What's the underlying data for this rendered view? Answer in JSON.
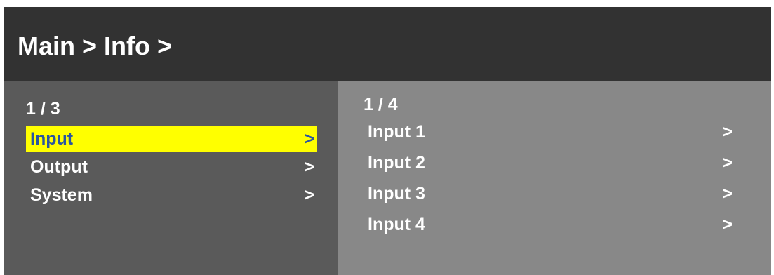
{
  "header": {
    "title": "Main > Info >"
  },
  "left_menu": {
    "page_indicator": "1 / 3",
    "items": [
      {
        "label": "Input",
        "chevron": ">",
        "selected": true
      },
      {
        "label": "Output",
        "chevron": ">",
        "selected": false
      },
      {
        "label": "System",
        "chevron": ">",
        "selected": false
      }
    ]
  },
  "right_menu": {
    "page_indicator": "1 / 4",
    "items": [
      {
        "label": "Input  1",
        "chevron": ">"
      },
      {
        "label": "Input  2",
        "chevron": ">"
      },
      {
        "label": "Input  3",
        "chevron": ">"
      },
      {
        "label": "Input  4",
        "chevron": ">"
      }
    ]
  },
  "colors": {
    "header_bg": "#323232",
    "left_pane_bg": "#5a5a5a",
    "right_pane_bg": "#888888",
    "selection_bg": "#ffff00",
    "selection_text": "#2a55a0",
    "text": "#ffffff"
  }
}
